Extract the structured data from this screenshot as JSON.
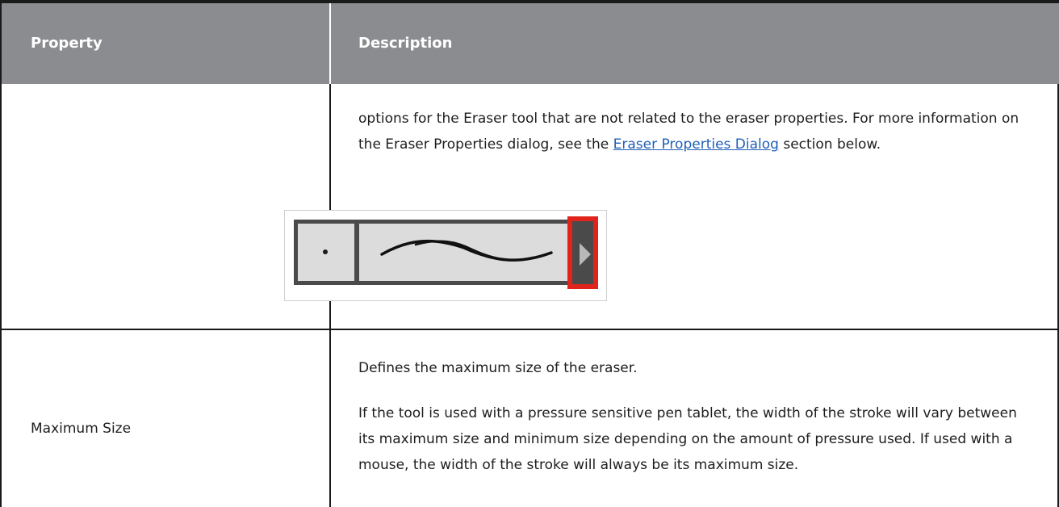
{
  "table": {
    "headers": {
      "property": "Property",
      "description": "Description"
    },
    "rows": [
      {
        "property": "",
        "description_before_link": "options for the Eraser tool that are not related to the eraser properties. For more information on the Eraser Properties dialog, see the ",
        "link": "Eraser Properties Dialog",
        "description_after_link": " section below.",
        "preview_widget": {
          "dot_icon": "brush-tip-dot",
          "stroke_icon": "stroke-preview-curve",
          "button_icon": "play-arrow-icon",
          "highlight_color": "#e0241c"
        }
      },
      {
        "property": "Maximum Size",
        "paragraphs": [
          "Defines the maximum size of the eraser.",
          "If the tool is used with a pressure sensitive pen tablet, the width of the stroke will vary between its maximum size and minimum size depending on the amount of pressure used. If used with a mouse, the width of the stroke will always be its maximum size."
        ]
      }
    ]
  }
}
